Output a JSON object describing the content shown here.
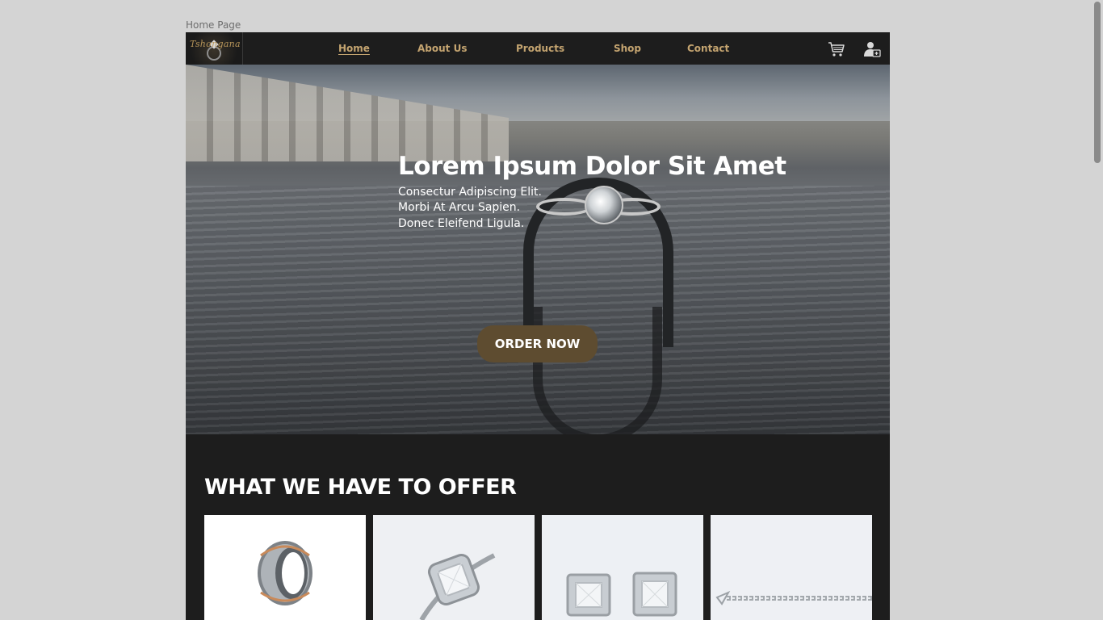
{
  "page_label": "Home Page",
  "brand": {
    "logo_text": "Tshongana"
  },
  "nav": {
    "items": [
      {
        "label": "Home",
        "active": true
      },
      {
        "label": "About Us",
        "active": false
      },
      {
        "label": "Products",
        "active": false
      },
      {
        "label": "Shop",
        "active": false
      },
      {
        "label": "Contact",
        "active": false
      }
    ],
    "icons": [
      "cart-icon",
      "user-account-icon"
    ]
  },
  "hero": {
    "title": "Lorem Ipsum Dolor Sit Amet",
    "subtitle_lines": [
      "Consectur Adipiscing Elit.",
      "Morbi At Arcu Sapien.",
      "Donec Eleifend Ligula."
    ],
    "cta_label": "ORDER NOW"
  },
  "offer": {
    "title": "WHAT WE HAVE TO OFFER",
    "products": [
      {
        "image": "tungsten-band-ring"
      },
      {
        "image": "halo-diamond-ring"
      },
      {
        "image": "princess-cut-stud-earrings"
      },
      {
        "image": "tennis-bracelet"
      }
    ]
  },
  "colors": {
    "background": "#d4d4d4",
    "nav_bg": "#1d1d1d",
    "nav_link": "#c4a470",
    "cta_bg": "#5e4c30",
    "section_bg": "#1d1d1d"
  }
}
